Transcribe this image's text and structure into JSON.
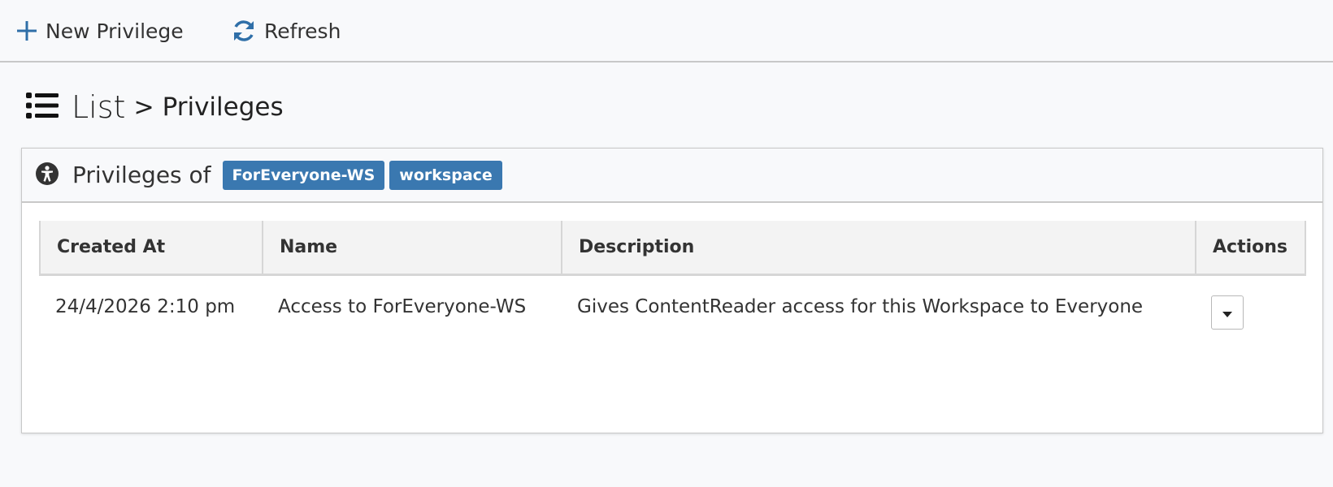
{
  "toolbar": {
    "new_label": "New Privilege",
    "refresh_label": "Refresh"
  },
  "heading": {
    "list": "List",
    "separator": ">",
    "page": "Privileges"
  },
  "panel": {
    "title": "Privileges of",
    "badges": [
      "ForEveryone-WS",
      "workspace"
    ]
  },
  "table": {
    "headers": [
      "Created At",
      "Name",
      "Description",
      "Actions"
    ],
    "rows": [
      {
        "created_at": "24/4/2026 2:10 pm",
        "name": "Access to ForEveryone-WS",
        "description": "Gives ContentReader access for this Workspace to Everyone"
      }
    ]
  },
  "colors": {
    "accent": "#3a78b0",
    "background": "#f8f9fb"
  },
  "icons": {
    "new": "plus-icon",
    "refresh": "refresh-icon",
    "list": "list-icon",
    "panel": "accessibility-icon",
    "action": "caret-down-icon"
  }
}
